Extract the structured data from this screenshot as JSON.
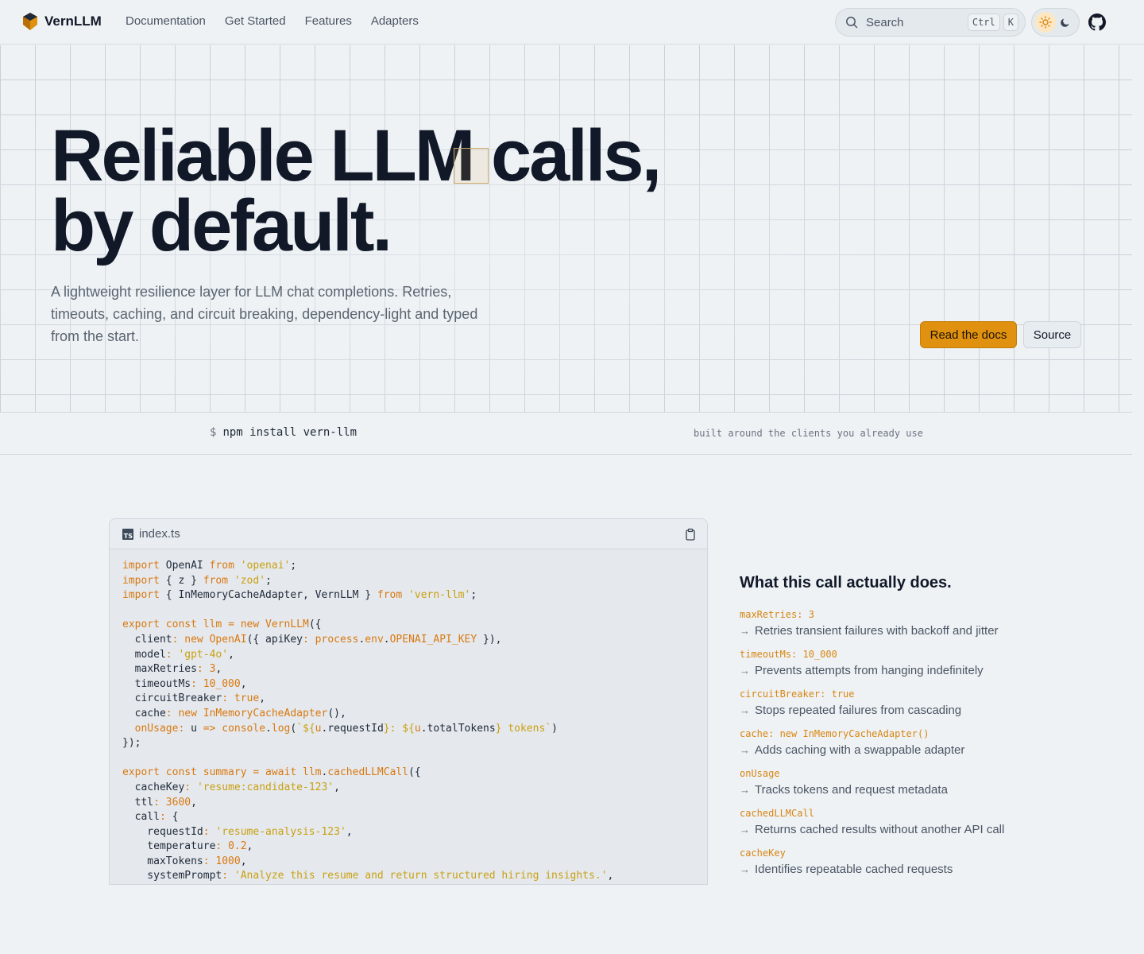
{
  "nav": {
    "brand": "VernLLM",
    "links": [
      "Documentation",
      "Get Started",
      "Features",
      "Adapters"
    ],
    "search_placeholder": "Search",
    "shortcut_keys": [
      "Ctrl",
      "K"
    ]
  },
  "hero": {
    "title_line1": "Reliable LLM calls,",
    "title_line2": "by default.",
    "subtitle": "A lightweight resilience layer for LLM chat completions. Retries, timeouts, caching, and circuit breaking, dependency-light and typed from the start.",
    "primary_button": "Read the docs",
    "secondary_button": "Source"
  },
  "install": {
    "prompt": "$",
    "command": "npm install vern-llm",
    "note": "built around the clients you already use"
  },
  "code": {
    "file_icon": "TS",
    "file_name": "index.ts",
    "lines": [
      [
        [
          "kw",
          "import"
        ],
        [
          "t",
          " OpenAI "
        ],
        [
          "kw",
          "from"
        ],
        [
          "t",
          " "
        ],
        [
          "str",
          "'openai'"
        ],
        [
          "t",
          ";"
        ]
      ],
      [
        [
          "kw",
          "import"
        ],
        [
          "t",
          " { z } "
        ],
        [
          "kw",
          "from"
        ],
        [
          "t",
          " "
        ],
        [
          "str",
          "'zod'"
        ],
        [
          "t",
          ";"
        ]
      ],
      [
        [
          "kw",
          "import"
        ],
        [
          "t",
          " { InMemoryCacheAdapter, VernLLM } "
        ],
        [
          "kw",
          "from"
        ],
        [
          "t",
          " "
        ],
        [
          "str",
          "'vern-llm'"
        ],
        [
          "t",
          ";"
        ]
      ],
      [],
      [
        [
          "kw",
          "export const"
        ],
        [
          "t",
          " "
        ],
        [
          "fn",
          "llm"
        ],
        [
          "t",
          " "
        ],
        [
          "kw",
          "="
        ],
        [
          "t",
          " "
        ],
        [
          "kw",
          "new"
        ],
        [
          "t",
          " "
        ],
        [
          "fn",
          "VernLLM"
        ],
        [
          "t",
          "({"
        ]
      ],
      [
        [
          "t",
          "  client"
        ],
        [
          "kw",
          ":"
        ],
        [
          "t",
          " "
        ],
        [
          "kw",
          "new"
        ],
        [
          "t",
          " "
        ],
        [
          "fn",
          "OpenAI"
        ],
        [
          "t",
          "({ apiKey"
        ],
        [
          "kw",
          ":"
        ],
        [
          "t",
          " "
        ],
        [
          "fn",
          "process"
        ],
        [
          "t",
          "."
        ],
        [
          "fn",
          "env"
        ],
        [
          "t",
          "."
        ],
        [
          "fn",
          "OPENAI_API_KEY"
        ],
        [
          "t",
          " }),"
        ]
      ],
      [
        [
          "t",
          "  model"
        ],
        [
          "kw",
          ":"
        ],
        [
          "t",
          " "
        ],
        [
          "str",
          "'gpt-4o'"
        ],
        [
          "t",
          ","
        ]
      ],
      [
        [
          "t",
          "  maxRetries"
        ],
        [
          "kw",
          ":"
        ],
        [
          "t",
          " "
        ],
        [
          "num",
          "3"
        ],
        [
          "t",
          ","
        ]
      ],
      [
        [
          "t",
          "  timeoutMs"
        ],
        [
          "kw",
          ":"
        ],
        [
          "t",
          " "
        ],
        [
          "num",
          "10_000"
        ],
        [
          "t",
          ","
        ]
      ],
      [
        [
          "t",
          "  circuitBreaker"
        ],
        [
          "kw",
          ":"
        ],
        [
          "t",
          " "
        ],
        [
          "num",
          "true"
        ],
        [
          "t",
          ","
        ]
      ],
      [
        [
          "t",
          "  cache"
        ],
        [
          "kw",
          ":"
        ],
        [
          "t",
          " "
        ],
        [
          "kw",
          "new"
        ],
        [
          "t",
          " "
        ],
        [
          "fn",
          "InMemoryCacheAdapter"
        ],
        [
          "t",
          "(),"
        ]
      ],
      [
        [
          "t",
          "  "
        ],
        [
          "kw",
          "onUsage"
        ],
        [
          "kw",
          ":"
        ],
        [
          "t",
          " u "
        ],
        [
          "kw",
          "=>"
        ],
        [
          "t",
          " "
        ],
        [
          "fn",
          "console"
        ],
        [
          "t",
          "."
        ],
        [
          "fn",
          "log"
        ],
        [
          "t",
          "("
        ],
        [
          "str",
          "`${"
        ],
        [
          "fn",
          "u"
        ],
        [
          "t",
          ".requestId"
        ],
        [
          "str",
          "}: ${"
        ],
        [
          "fn",
          "u"
        ],
        [
          "t",
          ".totalTokens"
        ],
        [
          "str",
          "} tokens`"
        ],
        [
          "t",
          ")"
        ]
      ],
      [
        [
          "t",
          "});"
        ]
      ],
      [],
      [
        [
          "kw",
          "export const"
        ],
        [
          "t",
          " "
        ],
        [
          "fn",
          "summary"
        ],
        [
          "t",
          " "
        ],
        [
          "kw",
          "="
        ],
        [
          "t",
          " "
        ],
        [
          "kw",
          "await"
        ],
        [
          "t",
          " "
        ],
        [
          "fn",
          "llm"
        ],
        [
          "t",
          "."
        ],
        [
          "fn",
          "cachedLLMCall"
        ],
        [
          "t",
          "({"
        ]
      ],
      [
        [
          "t",
          "  cacheKey"
        ],
        [
          "kw",
          ":"
        ],
        [
          "t",
          " "
        ],
        [
          "str",
          "'resume:candidate-123'"
        ],
        [
          "t",
          ","
        ]
      ],
      [
        [
          "t",
          "  ttl"
        ],
        [
          "kw",
          ":"
        ],
        [
          "t",
          " "
        ],
        [
          "num",
          "3600"
        ],
        [
          "t",
          ","
        ]
      ],
      [
        [
          "t",
          "  call"
        ],
        [
          "kw",
          ":"
        ],
        [
          "t",
          " {"
        ]
      ],
      [
        [
          "t",
          "    requestId"
        ],
        [
          "kw",
          ":"
        ],
        [
          "t",
          " "
        ],
        [
          "str",
          "'resume-analysis-123'"
        ],
        [
          "t",
          ","
        ]
      ],
      [
        [
          "t",
          "    temperature"
        ],
        [
          "kw",
          ":"
        ],
        [
          "t",
          " "
        ],
        [
          "num",
          "0.2"
        ],
        [
          "t",
          ","
        ]
      ],
      [
        [
          "t",
          "    maxTokens"
        ],
        [
          "kw",
          ":"
        ],
        [
          "t",
          " "
        ],
        [
          "num",
          "1000"
        ],
        [
          "t",
          ","
        ]
      ],
      [
        [
          "t",
          "    systemPrompt"
        ],
        [
          "kw",
          ":"
        ],
        [
          "t",
          " "
        ],
        [
          "str",
          "'Analyze this resume and return structured hiring insights.'"
        ],
        [
          "t",
          ","
        ]
      ]
    ]
  },
  "explain": {
    "title": "What this call actually does.",
    "items": [
      {
        "key": "maxRetries: 3",
        "desc": "Retries transient failures with backoff and jitter"
      },
      {
        "key": "timeoutMs: 10_000",
        "desc": "Prevents attempts from hanging indefinitely"
      },
      {
        "key": "circuitBreaker: true",
        "desc": "Stops repeated failures from cascading"
      },
      {
        "key": "cache: new InMemoryCacheAdapter()",
        "desc": "Adds caching with a swappable adapter"
      },
      {
        "key": "onUsage",
        "desc": "Tracks tokens and request metadata"
      },
      {
        "key": "cachedLLMCall",
        "desc": "Returns cached results without another API call"
      },
      {
        "key": "cacheKey",
        "desc": "Identifies repeatable cached requests"
      }
    ]
  },
  "colors": {
    "accent": "#e0910f",
    "keyword": "#d9780f",
    "string": "#c9a010",
    "text": "#111827"
  }
}
